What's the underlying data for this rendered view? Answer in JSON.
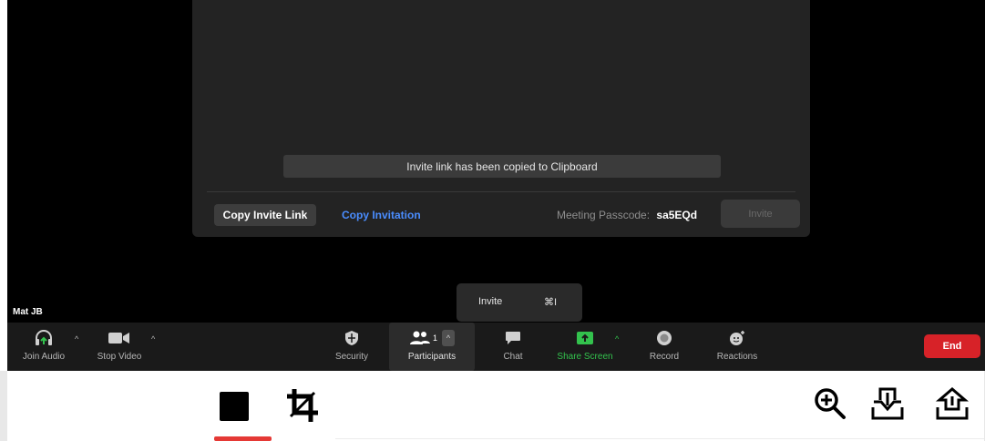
{
  "meeting": {
    "toast": "Invite link has been copied to Clipboard",
    "copy_invite_link": "Copy Invite Link",
    "copy_invitation": "Copy Invitation",
    "passcode_label": "Meeting Passcode:",
    "passcode_value": "sa5EQd",
    "invite_button": "Invite",
    "participant_name": "Mat JB"
  },
  "tooltip": {
    "label": "Invite",
    "shortcut": "⌘I"
  },
  "toolbar": {
    "join_audio": "Join Audio",
    "stop_video": "Stop Video",
    "security": "Security",
    "participants": "Participants",
    "participant_count": "1",
    "chat": "Chat",
    "share_screen": "Share Screen",
    "record": "Record",
    "reactions": "Reactions",
    "end": "End"
  },
  "colors": {
    "end": "#d72228",
    "share_screen": "#33c24d",
    "link_blue": "#4a8dff",
    "recording_indicator": "#e53935"
  },
  "bottom_tools": {
    "left": [
      "stop-square-icon",
      "crop-icon"
    ],
    "right": [
      "zoom-in-icon",
      "download-icon",
      "upload-icon"
    ]
  }
}
